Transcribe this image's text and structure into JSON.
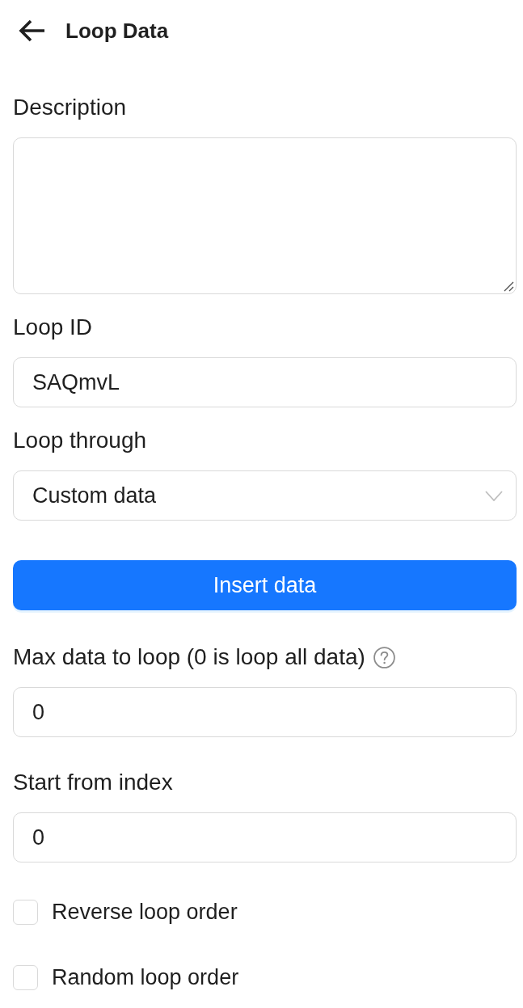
{
  "header": {
    "title": "Loop Data"
  },
  "fields": [
    {
      "kind": "textarea",
      "label": "Description"
    },
    {
      "kind": "input",
      "label": "Loop ID",
      "value": "SAQmvL"
    },
    {
      "kind": "select",
      "label": "Loop through",
      "value": "Custom data"
    }
  ],
  "insert_button": {
    "label": "Insert data"
  },
  "limits": [
    {
      "kind": "input",
      "label": "Max data to loop (0 is loop all data)",
      "help": true,
      "value": "0"
    },
    {
      "kind": "input",
      "label": "Start from index",
      "help": false,
      "value": "0"
    }
  ],
  "options": [
    {
      "label": "Reverse loop order",
      "checked": false
    },
    {
      "label": "Random loop order",
      "checked": false
    }
  ]
}
